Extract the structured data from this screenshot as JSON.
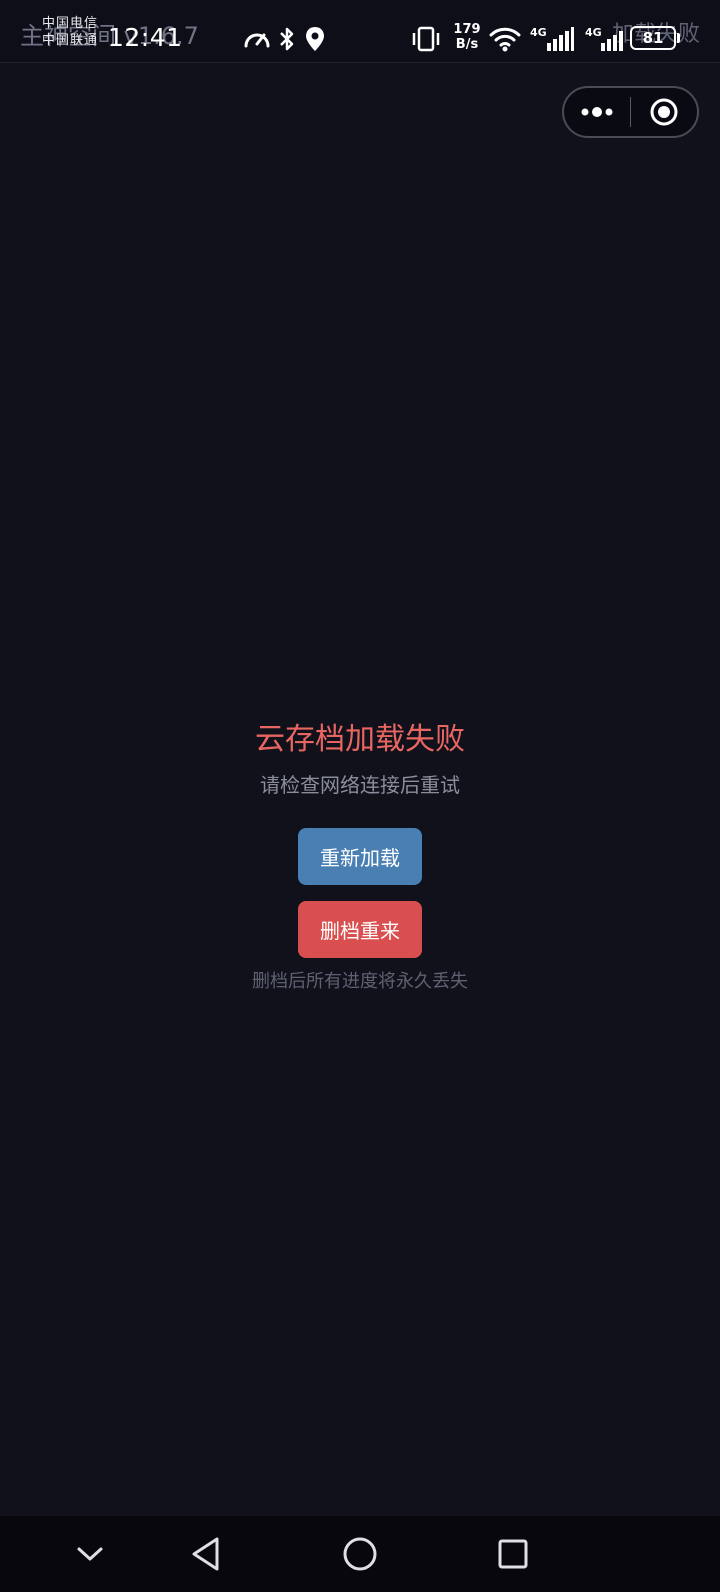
{
  "status_bar": {
    "background_app_title": "主神空间 v1.6.7",
    "background_app_status": "加载失败",
    "carriers": [
      "中国电信",
      "中国联通"
    ],
    "time": "12:41",
    "net_speed_value": "179",
    "net_speed_unit": "B/s",
    "signal_1_label": "4G",
    "signal_2_label": "4G",
    "battery_level": "81",
    "icons": [
      "speedometer-icon",
      "bluetooth-icon",
      "location-icon",
      "vibrate-icon",
      "wifi-icon",
      "signal-icon",
      "battery-icon"
    ]
  },
  "capsule": {
    "more_icon": "more-dots-icon",
    "close_icon": "target-close-icon"
  },
  "error": {
    "title": "云存档加载失败",
    "subtitle": "请检查网络连接后重试",
    "reload_label": "重新加载",
    "delete_label": "删档重来",
    "warning": "删档后所有进度将永久丢失",
    "colors": {
      "title": "#e86661",
      "reload_button": "#4a7fb3",
      "delete_button": "#d94f4f",
      "background": "#10111b"
    }
  },
  "nav_bar": {
    "icons": [
      "chevron-down-icon",
      "back-triangle-icon",
      "home-circle-icon",
      "recents-square-icon"
    ]
  }
}
